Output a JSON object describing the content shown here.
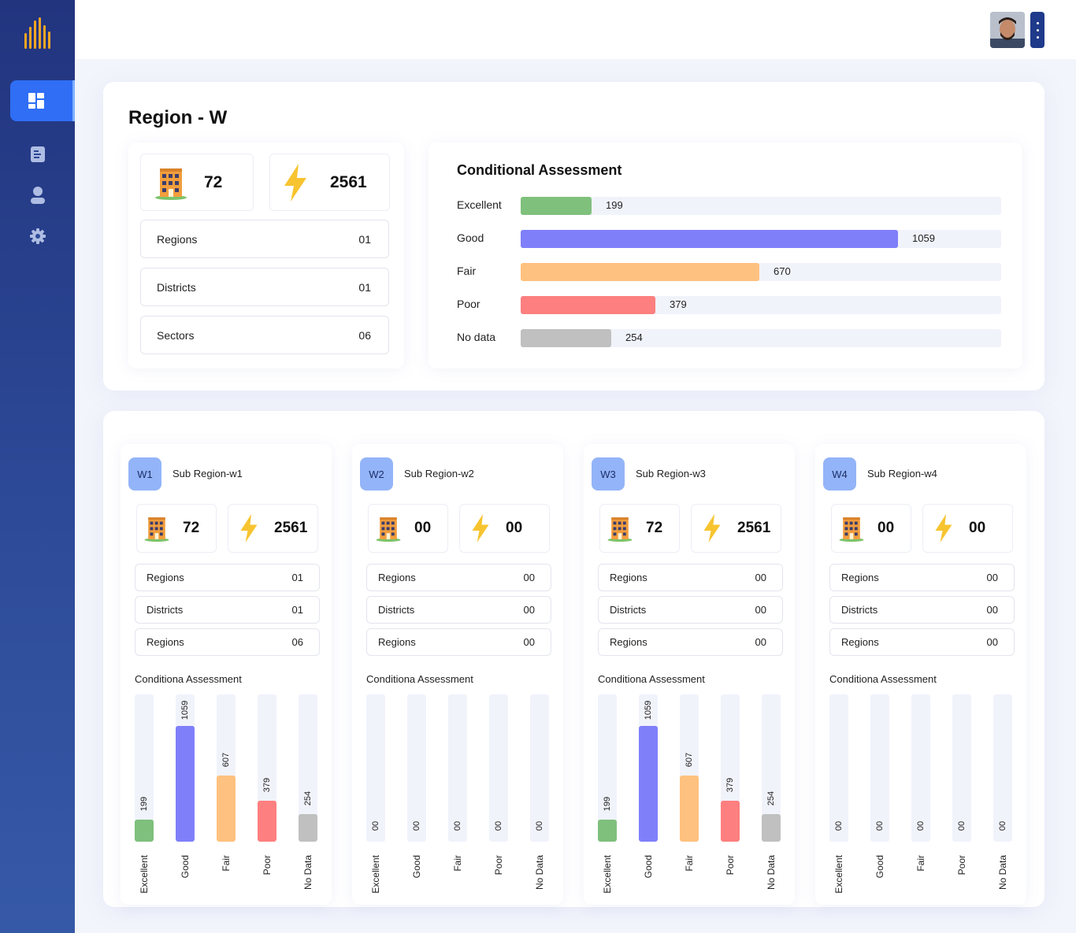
{
  "nav": {
    "items": [
      {
        "icon": "dashboard-icon",
        "active": true
      },
      {
        "icon": "document-icon",
        "active": false
      },
      {
        "icon": "user-icon",
        "active": false
      },
      {
        "icon": "gear-icon",
        "active": false
      }
    ]
  },
  "header": {
    "avatar": "user-avatar"
  },
  "region": {
    "title": "Region - W",
    "buildings": "72",
    "power": "2561",
    "rows": [
      {
        "label": "Regions",
        "value": "01"
      },
      {
        "label": "Districts",
        "value": "01"
      },
      {
        "label": "Sectors",
        "value": "06"
      }
    ]
  },
  "assessment": {
    "title": "Conditional Assessment",
    "bars": [
      {
        "label": "Excellent",
        "value": 199,
        "color": "#7fc07d"
      },
      {
        "label": "Good",
        "value": 1059,
        "color": "#7f7ffa"
      },
      {
        "label": "Fair",
        "value": 670,
        "color": "#ffc17f"
      },
      {
        "label": "Poor",
        "value": 379,
        "color": "#fd7f7f"
      },
      {
        "label": "No data",
        "value": 254,
        "color": "#c0c0c0"
      }
    ],
    "max": 1350
  },
  "subregions": [
    {
      "badge": "W1",
      "name": "Sub Region-w1",
      "buildings": "72",
      "power": "2561",
      "rows": [
        {
          "label": "Regions",
          "value": "01"
        },
        {
          "label": "Districts",
          "value": "01"
        },
        {
          "label": "Regions",
          "value": "06"
        }
      ],
      "ca_title": "Conditiona Assessment",
      "bars": [
        {
          "label": "Excellent",
          "value": 199,
          "text": "199",
          "color": "#7fc07d"
        },
        {
          "label": "Good",
          "value": 1059,
          "text": "1059",
          "color": "#7f7ffa"
        },
        {
          "label": "Fair",
          "value": 607,
          "text": "607",
          "color": "#ffc17f"
        },
        {
          "label": "Poor",
          "value": 379,
          "text": "379",
          "color": "#fd7f7f"
        },
        {
          "label": "No Data",
          "value": 254,
          "text": "254",
          "color": "#c0c0c0"
        }
      ]
    },
    {
      "badge": "W2",
      "name": "Sub Region-w2",
      "buildings": "00",
      "power": "00",
      "rows": [
        {
          "label": "Regions",
          "value": "00"
        },
        {
          "label": "Districts",
          "value": "00"
        },
        {
          "label": "Regions",
          "value": "00"
        }
      ],
      "ca_title": "Conditiona Assessment",
      "bars": [
        {
          "label": "Excellent",
          "value": 0,
          "text": "00",
          "color": "#7fc07d"
        },
        {
          "label": "Good",
          "value": 0,
          "text": "00",
          "color": "#7f7ffa"
        },
        {
          "label": "Fair",
          "value": 0,
          "text": "00",
          "color": "#ffc17f"
        },
        {
          "label": "Poor",
          "value": 0,
          "text": "00",
          "color": "#fd7f7f"
        },
        {
          "label": "No Data",
          "value": 0,
          "text": "00",
          "color": "#c0c0c0"
        }
      ]
    },
    {
      "badge": "W3",
      "name": "Sub Region-w3",
      "buildings": "72",
      "power": "2561",
      "rows": [
        {
          "label": "Regions",
          "value": "00"
        },
        {
          "label": "Districts",
          "value": "00"
        },
        {
          "label": "Regions",
          "value": "00"
        }
      ],
      "ca_title": "Conditiona Assessment",
      "bars": [
        {
          "label": "Excellent",
          "value": 199,
          "text": "199",
          "color": "#7fc07d"
        },
        {
          "label": "Good",
          "value": 1059,
          "text": "1059",
          "color": "#7f7ffa"
        },
        {
          "label": "Fair",
          "value": 607,
          "text": "607",
          "color": "#ffc17f"
        },
        {
          "label": "Poor",
          "value": 379,
          "text": "379",
          "color": "#fd7f7f"
        },
        {
          "label": "No Data",
          "value": 254,
          "text": "254",
          "color": "#c0c0c0"
        }
      ]
    },
    {
      "badge": "W4",
      "name": "Sub Region-w4",
      "buildings": "00",
      "power": "00",
      "rows": [
        {
          "label": "Regions",
          "value": "00"
        },
        {
          "label": "Districts",
          "value": "00"
        },
        {
          "label": "Regions",
          "value": "00"
        }
      ],
      "ca_title": "Conditiona Assessment",
      "bars": [
        {
          "label": "Excellent",
          "value": 0,
          "text": "00",
          "color": "#7fc07d"
        },
        {
          "label": "Good",
          "value": 0,
          "text": "00",
          "color": "#7f7ffa"
        },
        {
          "label": "Fair",
          "value": 0,
          "text": "00",
          "color": "#ffc17f"
        },
        {
          "label": "Poor",
          "value": 0,
          "text": "00",
          "color": "#fd7f7f"
        },
        {
          "label": "No Data",
          "value": 0,
          "text": "00",
          "color": "#c0c0c0"
        }
      ]
    }
  ]
}
